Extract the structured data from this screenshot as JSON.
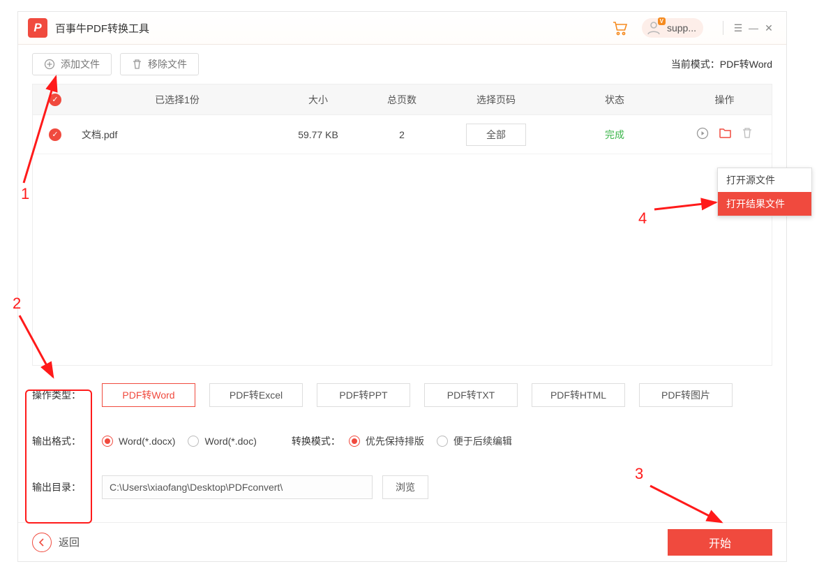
{
  "app": {
    "title": "百事牛PDF转换工具",
    "logo_letter": "P",
    "user_name": "supp...",
    "vip_badge": "V"
  },
  "toolbar": {
    "add_file": "添加文件",
    "remove_file": "移除文件",
    "current_mode_label": "当前模式：",
    "current_mode_value": "PDF转Word"
  },
  "table": {
    "headers": {
      "selected": "已选择1份",
      "size": "大小",
      "pages": "总页数",
      "range": "选择页码",
      "status": "状态",
      "ops": "操作"
    },
    "rows": [
      {
        "name": "文档.pdf",
        "size": "59.77 KB",
        "pages": "2",
        "range": "全部",
        "status": "完成"
      }
    ]
  },
  "context_menu": {
    "open_source": "打开源文件",
    "open_result": "打开结果文件"
  },
  "settings": {
    "type_label": "操作类型：",
    "types": [
      "PDF转Word",
      "PDF转Excel",
      "PDF转PPT",
      "PDF转TXT",
      "PDF转HTML",
      "PDF转图片"
    ],
    "format_label": "输出格式：",
    "format_options": [
      "Word(*.docx)",
      "Word(*.doc)"
    ],
    "mode_label": "转换模式：",
    "mode_options": [
      "优先保持排版",
      "便于后续编辑"
    ],
    "dir_label": "输出目录：",
    "dir_value": "C:\\Users\\xiaofang\\Desktop\\PDFconvert\\",
    "browse": "浏览"
  },
  "bottom": {
    "back": "返回",
    "start": "开始"
  },
  "annotations": {
    "n1": "1",
    "n2": "2",
    "n3": "3",
    "n4": "4"
  }
}
